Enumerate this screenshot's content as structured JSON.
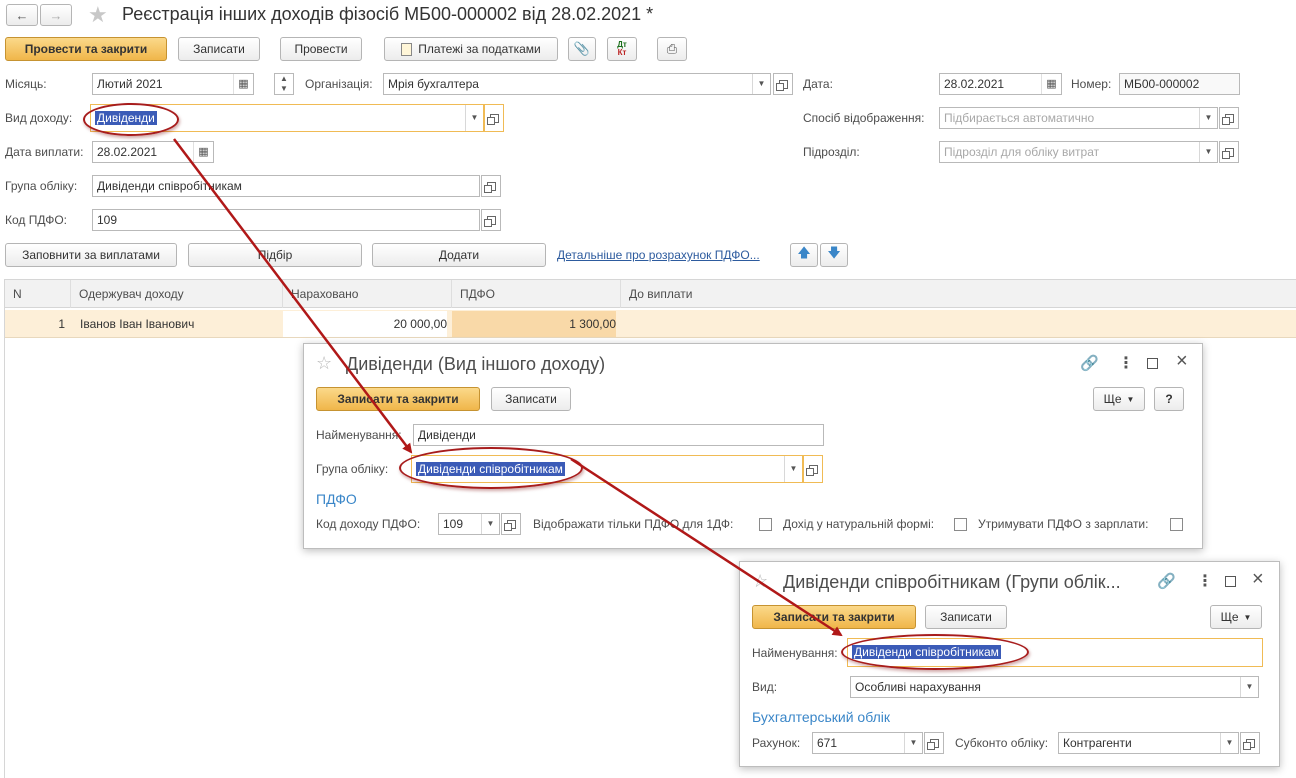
{
  "document": {
    "title": "Реєстрація інших доходів фізосіб МБ00-000002 від 28.02.2021 *",
    "toolbar": {
      "post_close": "Провести та закрити",
      "save": "Записати",
      "post": "Провести",
      "tax_payments": "Платежі за податками"
    },
    "fields": {
      "month_label": "Місяць:",
      "month_value": "Лютий 2021",
      "org_label": "Організація:",
      "org_value": "Мрія бухгалтера",
      "date_label": "Дата:",
      "date_value": "28.02.2021",
      "number_label": "Номер:",
      "number_value": "МБ00-000002",
      "income_type_label": "Вид доходу:",
      "income_type_value": "Дивіденди",
      "display_method_label": "Спосіб відображення:",
      "display_method_placeholder": "Підбирається автоматично",
      "pay_date_label": "Дата виплати:",
      "pay_date_value": "28.02.2021",
      "division_label": "Підрозділ:",
      "division_placeholder": "Підрозділ для обліку витрат",
      "account_group_label": "Група обліку:",
      "account_group_value": "Дивіденди співробітникам",
      "pdfo_code_label": "Код ПДФО:",
      "pdfo_code_value": "109"
    },
    "table_toolbar": {
      "fill": "Заповнити за виплатами",
      "pick": "Підбір",
      "add": "Додати",
      "details_link": "Детальніше про розрахунок ПДФО..."
    },
    "table": {
      "columns": [
        "N",
        "Одержувач доходу",
        "Нараховано",
        "ПДФО",
        "До виплати"
      ],
      "rows": [
        {
          "n": "1",
          "recipient": "Іванов Іван Іванович",
          "accrued": "20 000,00",
          "pdfo": "1 300,00",
          "payout": ""
        }
      ]
    }
  },
  "dialog1": {
    "title": "Дивіденди (Вид іншого доходу)",
    "save_close": "Записати та закрити",
    "save": "Записати",
    "more": "Ще",
    "help": "?",
    "name_label": "Найменування:",
    "name_value": "Дивіденди",
    "group_label": "Група обліку:",
    "group_value": "Дивіденди співробітникам",
    "section_pdfo": "ПДФО",
    "pdfo_code_label": "Код доходу ПДФО:",
    "pdfo_code_value": "109",
    "only_1df_label": "Відображати тільки ПДФО для 1ДФ:",
    "natural_label": "Дохід у натуральній формі:",
    "withhold_label": "Утримувати ПДФО з зарплати:"
  },
  "dialog2": {
    "title": "Дивіденди співробітникам (Групи облік...",
    "save_close": "Записати та закрити",
    "save": "Записати",
    "more": "Ще",
    "name_label": "Найменування:",
    "name_value": "Дивіденди співробітникам",
    "kind_label": "Вид:",
    "kind_value": "Особливі нарахування",
    "section_accounting": "Бухгалтерський облік",
    "account_label": "Рахунок:",
    "account_value": "671",
    "subconto_label": "Субконто обліку:",
    "subconto_value": "Контрагенти"
  },
  "colors": {
    "primary_button": "#f0b64a",
    "selection": "#3b5bb7",
    "focus_border": "#f0bb55",
    "section_text": "#3a86c8",
    "annotation": "#a71c1c",
    "row_highlight": "#fdefd8"
  }
}
